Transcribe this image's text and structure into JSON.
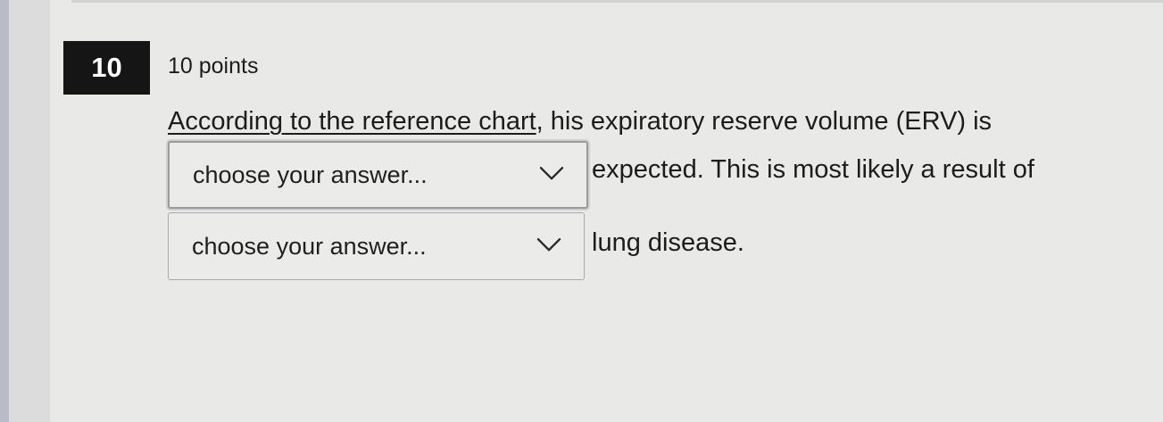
{
  "question": {
    "number": "10",
    "points": "10 points",
    "intro_link": "According to the reference chart",
    "intro_rest": ", his expiratory reserve volume (ERV) is",
    "after_first": "expected. This is most likely a result of",
    "after_second": "lung disease.",
    "dropdowns": [
      {
        "selected": "choose your answer...",
        "icon": "chevron-down-icon"
      },
      {
        "selected": "choose your answer...",
        "icon": "chevron-down-icon"
      }
    ]
  }
}
